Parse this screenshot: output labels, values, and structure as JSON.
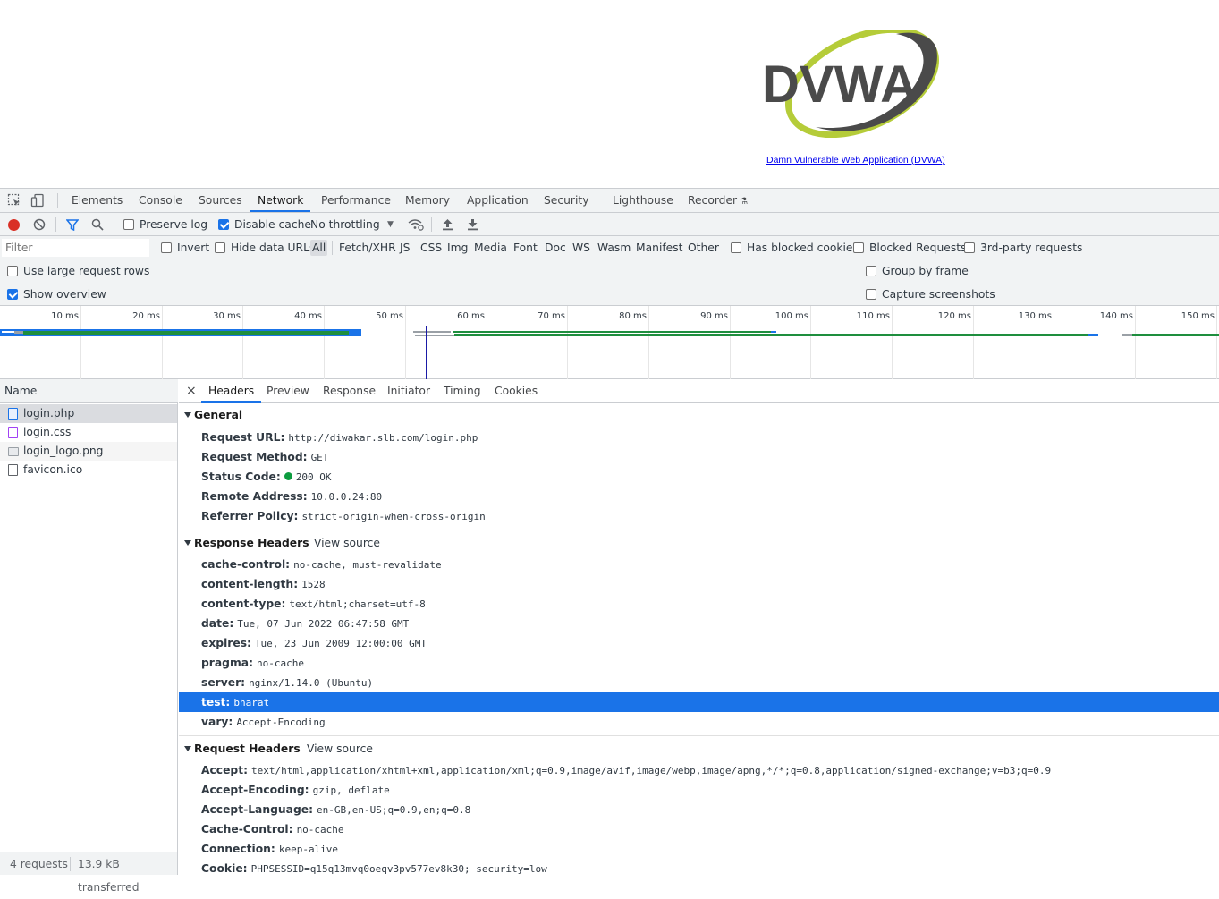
{
  "page": {
    "logo_text": "DVWA",
    "logo_link": "Damn Vulnerable Web Application (DVWA)"
  },
  "devtools": {
    "tabs": [
      "Elements",
      "Console",
      "Sources",
      "Network",
      "Performance",
      "Memory",
      "Application",
      "Security",
      "Lighthouse",
      "Recorder"
    ],
    "active_tab": "Network",
    "toolbar": {
      "preserve_log": "Preserve log",
      "disable_cache": "Disable cache",
      "throttling": "No throttling"
    },
    "filter": {
      "placeholder": "Filter",
      "invert": "Invert",
      "hide_data_urls": "Hide data URLs",
      "types": [
        "All",
        "Fetch/XHR",
        "JS",
        "CSS",
        "Img",
        "Media",
        "Font",
        "Doc",
        "WS",
        "Wasm",
        "Manifest",
        "Other"
      ],
      "has_blocked_cookies": "Has blocked cookies",
      "blocked_requests": "Blocked Requests",
      "third_party": "3rd-party requests"
    },
    "settings": {
      "large_rows": "Use large request rows",
      "show_overview": "Show overview",
      "group_by_frame": "Group by frame",
      "capture_screenshots": "Capture screenshots"
    },
    "overview_ticks": [
      "10 ms",
      "20 ms",
      "30 ms",
      "40 ms",
      "50 ms",
      "60 ms",
      "70 ms",
      "80 ms",
      "90 ms",
      "100 ms",
      "110 ms",
      "120 ms",
      "130 ms",
      "140 ms",
      "150 ms"
    ],
    "requests": {
      "header": "Name",
      "items": [
        "login.php",
        "login.css",
        "login_logo.png",
        "favicon.ico"
      ],
      "summary_count": "4 requests",
      "summary_transferred": "13.9 kB transferred"
    },
    "detail_tabs": [
      "Headers",
      "Preview",
      "Response",
      "Initiator",
      "Timing",
      "Cookies"
    ],
    "general": {
      "title": "General",
      "rows": [
        {
          "key": "Request URL:",
          "value": "http://diwakar.slb.com/login.php"
        },
        {
          "key": "Request Method:",
          "value": "GET"
        },
        {
          "key": "Status Code:",
          "value": "200 OK"
        },
        {
          "key": "Remote Address:",
          "value": "10.0.0.24:80"
        },
        {
          "key": "Referrer Policy:",
          "value": "strict-origin-when-cross-origin"
        }
      ]
    },
    "response_headers": {
      "title": "Response Headers",
      "view_source": "View source",
      "rows": [
        {
          "key": "cache-control:",
          "value": "no-cache, must-revalidate"
        },
        {
          "key": "content-length:",
          "value": "1528"
        },
        {
          "key": "content-type:",
          "value": "text/html;charset=utf-8"
        },
        {
          "key": "date:",
          "value": "Tue, 07 Jun 2022 06:47:58 GMT"
        },
        {
          "key": "expires:",
          "value": "Tue, 23 Jun 2009 12:00:00 GMT"
        },
        {
          "key": "pragma:",
          "value": "no-cache"
        },
        {
          "key": "server:",
          "value": "nginx/1.14.0 (Ubuntu)"
        },
        {
          "key": "test:",
          "value": "bharat"
        },
        {
          "key": "vary:",
          "value": "Accept-Encoding"
        }
      ]
    },
    "request_headers": {
      "title": "Request Headers",
      "view_source": "View source",
      "rows": [
        {
          "key": "Accept:",
          "value": "text/html,application/xhtml+xml,application/xml;q=0.9,image/avif,image/webp,image/apng,*/*;q=0.8,application/signed-exchange;v=b3;q=0.9"
        },
        {
          "key": "Accept-Encoding:",
          "value": "gzip, deflate"
        },
        {
          "key": "Accept-Language:",
          "value": "en-GB,en-US;q=0.9,en;q=0.8"
        },
        {
          "key": "Cache-Control:",
          "value": "no-cache"
        },
        {
          "key": "Connection:",
          "value": "keep-alive"
        },
        {
          "key": "Cookie:",
          "value": "PHPSESSID=q15q13mvq0oeqv3pv577ev8k30; security=low"
        }
      ]
    },
    "colors": {
      "accent": "#1a73e8",
      "record": "#d93025",
      "status_ok": "#0d9c3f"
    }
  }
}
